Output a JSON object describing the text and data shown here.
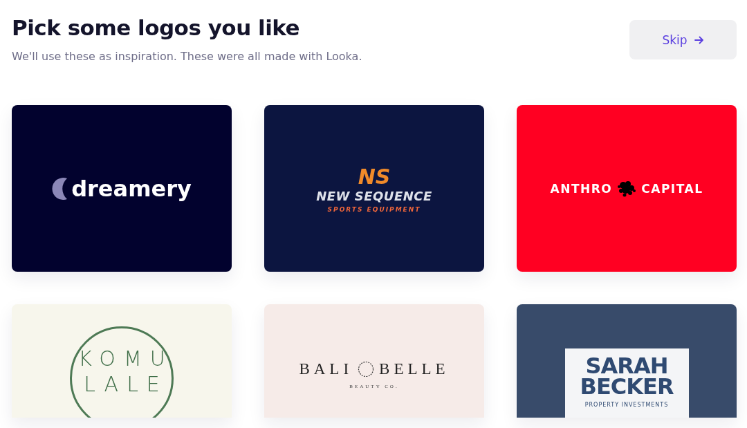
{
  "header": {
    "title": "Pick some logos you like",
    "subtitle": "We'll use these as inspiration. These were all made with Looka."
  },
  "skip_button": {
    "label": "Skip"
  },
  "logos": [
    {
      "kind": "dreamery",
      "selected": false,
      "texts": [
        "dreamery"
      ]
    },
    {
      "kind": "new_sequence",
      "selected": false,
      "texts": [
        "NS",
        "NEW SEQUENCE",
        "SPORTS EQUIPMENT"
      ]
    },
    {
      "kind": "anthro",
      "selected": false,
      "texts": [
        "ANTHRO",
        "CAPITAL"
      ]
    },
    {
      "kind": "komu",
      "selected": false,
      "texts": [
        "KOMU",
        "LALE"
      ]
    },
    {
      "kind": "bali",
      "selected": false,
      "texts": [
        "BALI",
        "BELLE",
        "BEAUTY CO."
      ]
    },
    {
      "kind": "sarah",
      "selected": false,
      "texts": [
        "SARAH",
        "BECKER",
        "PROPERTY INVESTMENTS"
      ]
    }
  ]
}
